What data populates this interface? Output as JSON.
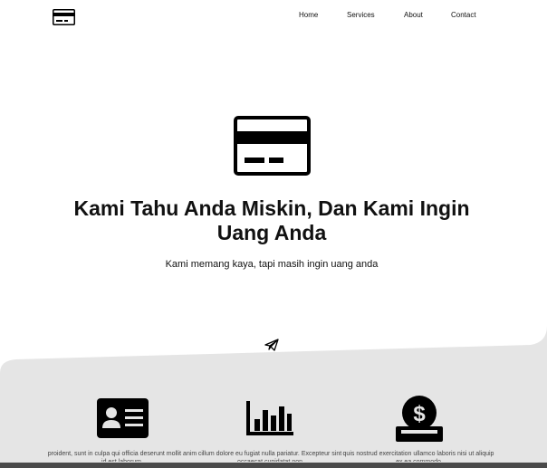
{
  "header": {
    "logo_icon": "credit-card-icon",
    "nav": [
      {
        "label": "Home"
      },
      {
        "label": "Services"
      },
      {
        "label": "About"
      },
      {
        "label": "Contact"
      }
    ]
  },
  "hero": {
    "icon": "credit-card-icon",
    "title": "Kami Tahu Anda Miskin, Dan Kami Ingin Uang Anda",
    "subtitle": "Kami memang kaya, tapi masih ingin uang anda",
    "action_icon": "paper-plane-icon"
  },
  "features": [
    {
      "icon": "id-card-icon",
      "text": "proident, sunt in culpa qui officia deserunt mollit anim id est laborum."
    },
    {
      "icon": "bar-chart-icon",
      "text": "cillum dolore eu fugiat nulla pariatur. Excepteur sint occaecat cupidatat non"
    },
    {
      "icon": "dollar-hand-icon",
      "text": "quis nostrud exercitation ullamco laboris nisi ut aliquip ex ea commodo"
    }
  ],
  "colors": {
    "background": "#ffffff",
    "features_background": "#e5e5e5",
    "icon": "#000000",
    "bottom_bar": "#4a4a4a"
  }
}
